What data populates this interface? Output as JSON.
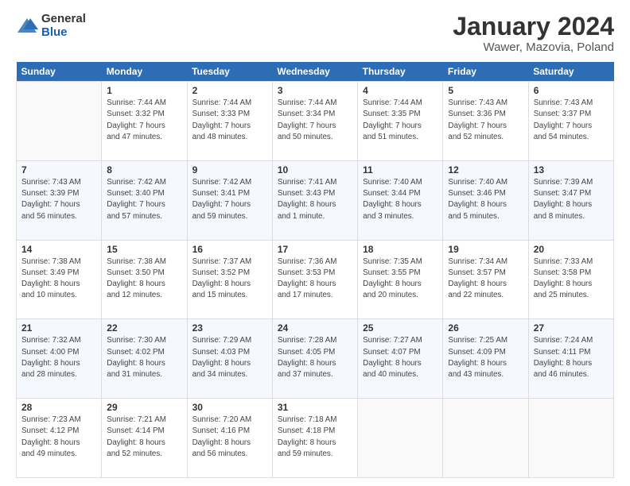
{
  "logo": {
    "general": "General",
    "blue": "Blue"
  },
  "header": {
    "title": "January 2024",
    "location": "Wawer, Mazovia, Poland"
  },
  "weekdays": [
    "Sunday",
    "Monday",
    "Tuesday",
    "Wednesday",
    "Thursday",
    "Friday",
    "Saturday"
  ],
  "weeks": [
    [
      {
        "day": "",
        "info": ""
      },
      {
        "day": "1",
        "info": "Sunrise: 7:44 AM\nSunset: 3:32 PM\nDaylight: 7 hours\nand 47 minutes."
      },
      {
        "day": "2",
        "info": "Sunrise: 7:44 AM\nSunset: 3:33 PM\nDaylight: 7 hours\nand 48 minutes."
      },
      {
        "day": "3",
        "info": "Sunrise: 7:44 AM\nSunset: 3:34 PM\nDaylight: 7 hours\nand 50 minutes."
      },
      {
        "day": "4",
        "info": "Sunrise: 7:44 AM\nSunset: 3:35 PM\nDaylight: 7 hours\nand 51 minutes."
      },
      {
        "day": "5",
        "info": "Sunrise: 7:43 AM\nSunset: 3:36 PM\nDaylight: 7 hours\nand 52 minutes."
      },
      {
        "day": "6",
        "info": "Sunrise: 7:43 AM\nSunset: 3:37 PM\nDaylight: 7 hours\nand 54 minutes."
      }
    ],
    [
      {
        "day": "7",
        "info": "Sunrise: 7:43 AM\nSunset: 3:39 PM\nDaylight: 7 hours\nand 56 minutes."
      },
      {
        "day": "8",
        "info": "Sunrise: 7:42 AM\nSunset: 3:40 PM\nDaylight: 7 hours\nand 57 minutes."
      },
      {
        "day": "9",
        "info": "Sunrise: 7:42 AM\nSunset: 3:41 PM\nDaylight: 7 hours\nand 59 minutes."
      },
      {
        "day": "10",
        "info": "Sunrise: 7:41 AM\nSunset: 3:43 PM\nDaylight: 8 hours\nand 1 minute."
      },
      {
        "day": "11",
        "info": "Sunrise: 7:40 AM\nSunset: 3:44 PM\nDaylight: 8 hours\nand 3 minutes."
      },
      {
        "day": "12",
        "info": "Sunrise: 7:40 AM\nSunset: 3:46 PM\nDaylight: 8 hours\nand 5 minutes."
      },
      {
        "day": "13",
        "info": "Sunrise: 7:39 AM\nSunset: 3:47 PM\nDaylight: 8 hours\nand 8 minutes."
      }
    ],
    [
      {
        "day": "14",
        "info": "Sunrise: 7:38 AM\nSunset: 3:49 PM\nDaylight: 8 hours\nand 10 minutes."
      },
      {
        "day": "15",
        "info": "Sunrise: 7:38 AM\nSunset: 3:50 PM\nDaylight: 8 hours\nand 12 minutes."
      },
      {
        "day": "16",
        "info": "Sunrise: 7:37 AM\nSunset: 3:52 PM\nDaylight: 8 hours\nand 15 minutes."
      },
      {
        "day": "17",
        "info": "Sunrise: 7:36 AM\nSunset: 3:53 PM\nDaylight: 8 hours\nand 17 minutes."
      },
      {
        "day": "18",
        "info": "Sunrise: 7:35 AM\nSunset: 3:55 PM\nDaylight: 8 hours\nand 20 minutes."
      },
      {
        "day": "19",
        "info": "Sunrise: 7:34 AM\nSunset: 3:57 PM\nDaylight: 8 hours\nand 22 minutes."
      },
      {
        "day": "20",
        "info": "Sunrise: 7:33 AM\nSunset: 3:58 PM\nDaylight: 8 hours\nand 25 minutes."
      }
    ],
    [
      {
        "day": "21",
        "info": "Sunrise: 7:32 AM\nSunset: 4:00 PM\nDaylight: 8 hours\nand 28 minutes."
      },
      {
        "day": "22",
        "info": "Sunrise: 7:30 AM\nSunset: 4:02 PM\nDaylight: 8 hours\nand 31 minutes."
      },
      {
        "day": "23",
        "info": "Sunrise: 7:29 AM\nSunset: 4:03 PM\nDaylight: 8 hours\nand 34 minutes."
      },
      {
        "day": "24",
        "info": "Sunrise: 7:28 AM\nSunset: 4:05 PM\nDaylight: 8 hours\nand 37 minutes."
      },
      {
        "day": "25",
        "info": "Sunrise: 7:27 AM\nSunset: 4:07 PM\nDaylight: 8 hours\nand 40 minutes."
      },
      {
        "day": "26",
        "info": "Sunrise: 7:25 AM\nSunset: 4:09 PM\nDaylight: 8 hours\nand 43 minutes."
      },
      {
        "day": "27",
        "info": "Sunrise: 7:24 AM\nSunset: 4:11 PM\nDaylight: 8 hours\nand 46 minutes."
      }
    ],
    [
      {
        "day": "28",
        "info": "Sunrise: 7:23 AM\nSunset: 4:12 PM\nDaylight: 8 hours\nand 49 minutes."
      },
      {
        "day": "29",
        "info": "Sunrise: 7:21 AM\nSunset: 4:14 PM\nDaylight: 8 hours\nand 52 minutes."
      },
      {
        "day": "30",
        "info": "Sunrise: 7:20 AM\nSunset: 4:16 PM\nDaylight: 8 hours\nand 56 minutes."
      },
      {
        "day": "31",
        "info": "Sunrise: 7:18 AM\nSunset: 4:18 PM\nDaylight: 8 hours\nand 59 minutes."
      },
      {
        "day": "",
        "info": ""
      },
      {
        "day": "",
        "info": ""
      },
      {
        "day": "",
        "info": ""
      }
    ]
  ]
}
